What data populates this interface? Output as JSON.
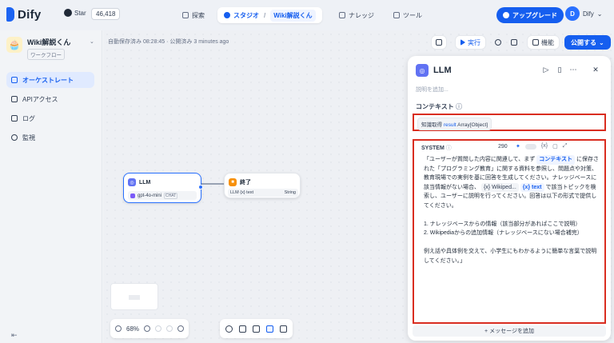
{
  "topbar": {
    "logo": "Dify",
    "github_label": "Star",
    "star_count": "46,418",
    "nav": {
      "explore": "探索",
      "studio": "スタジオ",
      "studio_app": "Wiki解説くん",
      "knowledge": "ナレッジ",
      "tools": "ツール"
    },
    "upgrade": "アップグレード",
    "user_initial": "D",
    "user_name": "Dify"
  },
  "sidebar": {
    "app_name": "Wiki解説くん",
    "app_type": "ワークフロー",
    "items": [
      {
        "label": "オーケストレート",
        "active": true
      },
      {
        "label": "APIアクセス",
        "active": false
      },
      {
        "label": "ログ",
        "active": false
      },
      {
        "label": "監視",
        "active": false
      }
    ]
  },
  "canvas": {
    "autosave": "自動保存済み 08:28:45 · 公開済み 3 minutes ago",
    "toolbar": {
      "run": "実行",
      "features": "機能",
      "publish": "公開する"
    },
    "nodes": {
      "llm": {
        "title": "LLM",
        "model": "gpt-4o-mini",
        "mode": "CHAT"
      },
      "end": {
        "title": "終了",
        "var_label": "LLM {x} text",
        "var_type": "String"
      }
    },
    "zoom": "68%"
  },
  "panel": {
    "title": "LLM",
    "description_placeholder": "説明を追加...",
    "context_label": "コンテキスト",
    "context_source": "知識取得",
    "context_var": "result",
    "context_type": "Array[Object]",
    "system_label": "SYSTEM",
    "token_count": "290",
    "prompt_pre": "「ユーザーが質問した内容に関連して、まず",
    "prompt_tag_context": "コンテキスト",
    "prompt_mid": "に保存された「プログラミング教育」に関する資料を参照し、問題点や対策、教育現場での実例を基に回答を生成してください。ナレッジベースに該当情報がない場合、",
    "prompt_tag_wiki": "{x} Wikiped...",
    "prompt_tag_text": "{x} text",
    "prompt_post": "で該当トピックを検索し、ユーザーに説明を行ってください。回答は以下の形式で提供してください。",
    "prompt_list1": "1. ナレッジベースからの情報（該当部分があればここで説明）",
    "prompt_list2": "2. Wikipediaからの追加情報（ナレッジベースにない場合補完）",
    "prompt_end": "例え話や具体例を交えて、小学生にもわかるように簡単な言葉で説明してください。」",
    "add_message": "+ メッセージを追加"
  }
}
